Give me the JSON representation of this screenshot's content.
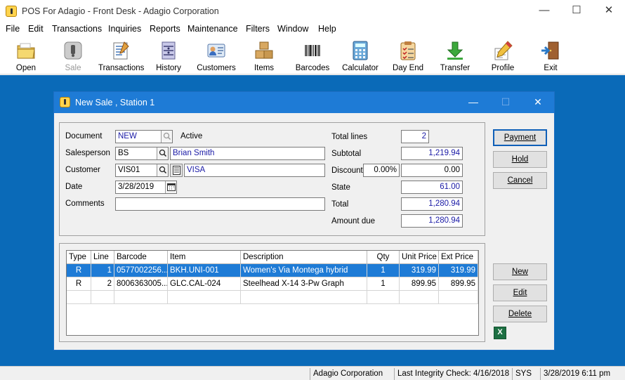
{
  "window": {
    "title": "POS For Adagio - Front Desk - Adagio Corporation"
  },
  "menu": [
    "File",
    "Edit",
    "Transactions",
    "Inquiries",
    "Reports",
    "Maintenance",
    "Filters",
    "Window",
    "Help"
  ],
  "toolbar": [
    {
      "label": "Open",
      "icon": "folder-icon",
      "enabled": true
    },
    {
      "label": "Sale",
      "icon": "sale-icon",
      "enabled": false
    },
    {
      "label": "Transactions",
      "icon": "transactions-icon",
      "enabled": true
    },
    {
      "label": "History",
      "icon": "history-icon",
      "enabled": true
    },
    {
      "label": "Customers",
      "icon": "customers-icon",
      "enabled": true
    },
    {
      "label": "Items",
      "icon": "items-icon",
      "enabled": true
    },
    {
      "label": "Barcodes",
      "icon": "barcode-icon",
      "enabled": true
    },
    {
      "label": "Calculator",
      "icon": "calculator-icon",
      "enabled": true
    },
    {
      "label": "Day End",
      "icon": "day-end-icon",
      "enabled": true
    },
    {
      "label": "Transfer",
      "icon": "transfer-icon",
      "enabled": true
    },
    {
      "label": "Profile",
      "icon": "profile-icon",
      "enabled": true
    },
    {
      "label": "Exit",
      "icon": "exit-icon",
      "enabled": true
    }
  ],
  "dialog": {
    "title": "New Sale , Station 1",
    "header": {
      "document_label": "Document",
      "document_value": "NEW",
      "document_status": "Active",
      "salesperson_label": "Salesperson",
      "salesperson_code": "BS",
      "salesperson_name": "Brian Smith",
      "customer_label": "Customer",
      "customer_code": "VIS01",
      "customer_name": "VISA",
      "date_label": "Date",
      "date_value": "3/28/2019",
      "comments_label": "Comments",
      "comments_value": ""
    },
    "totals": {
      "total_lines_label": "Total lines",
      "total_lines": "2",
      "subtotal_label": "Subtotal",
      "subtotal": "1,219.94",
      "discount_label": "Discount",
      "discount_pct": "0.00%",
      "discount": "0.00",
      "state_label": "State",
      "state": "61.00",
      "total_label": "Total",
      "total": "1,280.94",
      "amount_due_label": "Amount due",
      "amount_due": "1,280.94"
    },
    "buttons": {
      "payment": "Payment",
      "hold": "Hold",
      "cancel": "Cancel",
      "new": "New",
      "edit": "Edit",
      "delete": "Delete"
    },
    "grid": {
      "columns": [
        "Type",
        "Line",
        "Barcode",
        "Item",
        "Description",
        "Qty",
        "Unit Price",
        "Ext Price"
      ],
      "rows": [
        {
          "type": "R",
          "line": "1",
          "barcode": "0577002256...",
          "item": "BKH.UNI-001",
          "description": "Women's Via Montega hybrid",
          "qty": "1",
          "unit_price": "319.99",
          "ext_price": "319.99",
          "selected": true
        },
        {
          "type": "R",
          "line": "2",
          "barcode": "8006363005...",
          "item": "GLC.CAL-024",
          "description": "Steelhead X-14 3-Pw Graph",
          "qty": "1",
          "unit_price": "899.95",
          "ext_price": "899.95",
          "selected": false
        }
      ]
    }
  },
  "statusbar": {
    "company": "Adagio Corporation",
    "integrity": "Last Integrity Check: 4/16/2018",
    "user": "SYS",
    "datetime": "3/28/2019 6:11 pm"
  }
}
